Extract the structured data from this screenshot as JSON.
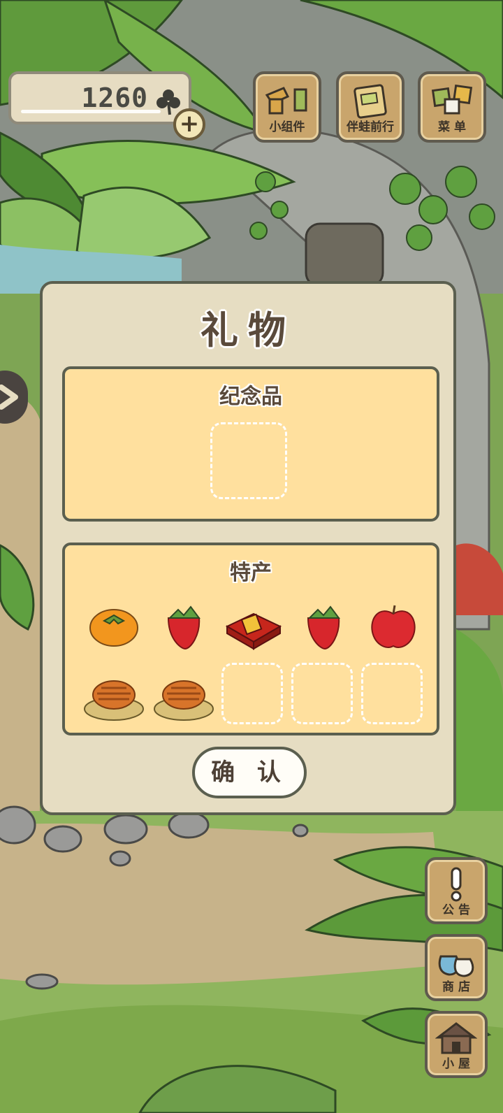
{
  "hud": {
    "clover_count": "1260",
    "buttons": [
      {
        "label": "小组件",
        "icon": "widget-icon"
      },
      {
        "label": "伴蛙前行",
        "icon": "travel-book-icon"
      },
      {
        "label": "菜 单",
        "icon": "menu-icon"
      }
    ],
    "side_buttons": [
      {
        "label": "公 告",
        "icon": "notice-icon"
      },
      {
        "label": "商 店",
        "icon": "shop-bags-icon"
      },
      {
        "label": "小 屋",
        "icon": "house-icon"
      }
    ]
  },
  "dialog": {
    "title": "礼物",
    "souvenir": {
      "title": "纪念品"
    },
    "specialty": {
      "title": "特产",
      "items": [
        "persimmon-icon",
        "strawberry-icon",
        "gift-box-icon",
        "strawberry-icon",
        "apple-icon",
        "fried-snack-icon",
        "fried-snack-icon"
      ]
    },
    "confirm_label": "确 认"
  },
  "colors": {
    "dialog_bg": "#e6ddc2",
    "section_bg": "#ffe09e",
    "border": "#5b5f4f",
    "button_wood": "#c9a56c"
  }
}
